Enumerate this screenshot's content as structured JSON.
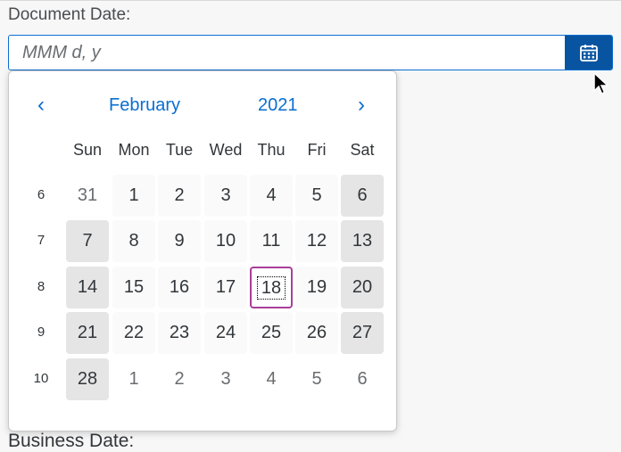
{
  "field": {
    "label": "Document Date:",
    "placeholder": "MMM d, y",
    "value": "",
    "picker_icon": "calendar-icon"
  },
  "calendar": {
    "prev_icon": "chevron-left-icon",
    "next_icon": "chevron-right-icon",
    "prev_glyph": "‹",
    "next_glyph": "›",
    "month": "February",
    "year": "2021",
    "weekdays": [
      "Sun",
      "Mon",
      "Tue",
      "Wed",
      "Thu",
      "Fri",
      "Sat"
    ],
    "weeks": [
      {
        "number": "6",
        "days": [
          {
            "label": "31",
            "state": "other"
          },
          {
            "label": "1",
            "state": "normal"
          },
          {
            "label": "2",
            "state": "normal"
          },
          {
            "label": "3",
            "state": "normal"
          },
          {
            "label": "4",
            "state": "normal"
          },
          {
            "label": "5",
            "state": "normal"
          },
          {
            "label": "6",
            "state": "weekend"
          }
        ]
      },
      {
        "number": "7",
        "days": [
          {
            "label": "7",
            "state": "weekend"
          },
          {
            "label": "8",
            "state": "normal"
          },
          {
            "label": "9",
            "state": "normal"
          },
          {
            "label": "10",
            "state": "normal"
          },
          {
            "label": "11",
            "state": "normal"
          },
          {
            "label": "12",
            "state": "normal"
          },
          {
            "label": "13",
            "state": "weekend"
          }
        ]
      },
      {
        "number": "8",
        "days": [
          {
            "label": "14",
            "state": "weekend"
          },
          {
            "label": "15",
            "state": "normal"
          },
          {
            "label": "16",
            "state": "normal"
          },
          {
            "label": "17",
            "state": "normal"
          },
          {
            "label": "18",
            "state": "today"
          },
          {
            "label": "19",
            "state": "normal"
          },
          {
            "label": "20",
            "state": "weekend"
          }
        ]
      },
      {
        "number": "9",
        "days": [
          {
            "label": "21",
            "state": "weekend"
          },
          {
            "label": "22",
            "state": "normal"
          },
          {
            "label": "23",
            "state": "normal"
          },
          {
            "label": "24",
            "state": "normal"
          },
          {
            "label": "25",
            "state": "normal"
          },
          {
            "label": "26",
            "state": "normal"
          },
          {
            "label": "27",
            "state": "weekend"
          }
        ]
      },
      {
        "number": "10",
        "days": [
          {
            "label": "28",
            "state": "weekend"
          },
          {
            "label": "1",
            "state": "other"
          },
          {
            "label": "2",
            "state": "other"
          },
          {
            "label": "3",
            "state": "other"
          },
          {
            "label": "4",
            "state": "other"
          },
          {
            "label": "5",
            "state": "other"
          },
          {
            "label": "6",
            "state": "other"
          }
        ]
      }
    ]
  },
  "next_field": {
    "label": "Business Date:"
  },
  "colors": {
    "accent": "#0a6ed1",
    "button": "#0854a0",
    "today_border": "#a93e9b",
    "weekend": "#e5e5e5"
  }
}
